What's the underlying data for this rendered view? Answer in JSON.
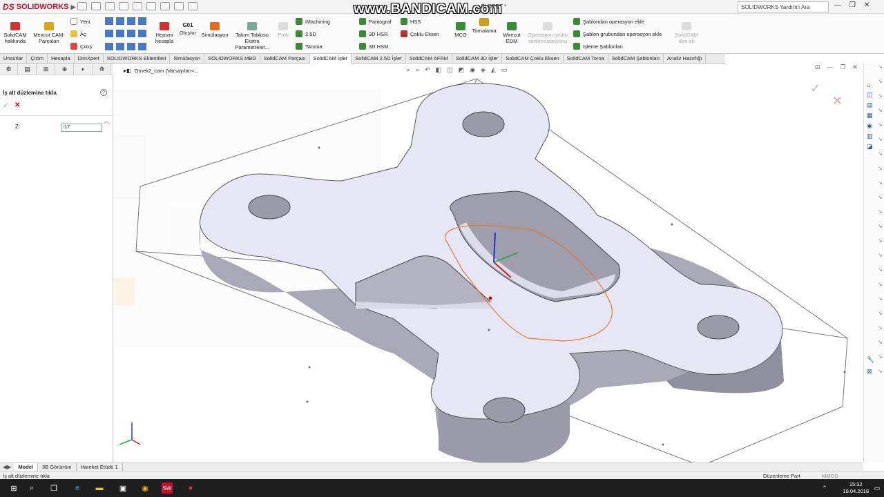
{
  "app": {
    "brand": "SOLIDWORKS",
    "watermark": "www.BANDICAM.com",
    "document_title": "...SLDPRT *"
  },
  "search": {
    "placeholder": "SOLIDWORKS Yardım'ı Ara"
  },
  "ribbon": {
    "solidcam_about": "SolidCAM hakkında",
    "existing_parts": "Mevcut CAM-Parçaları",
    "new": "Yeni",
    "open": "Aç",
    "exit": "Çıkış",
    "calc_all": "Hepsini hesapla",
    "gcode": "G01",
    "create": "Oluştur",
    "simulation": "Simülasyon",
    "tool_table_params": "Takım Tablosu Ekstra Parametreler...",
    "probe": "Prob",
    "imachining": "iMachining",
    "op25d": "2.5D",
    "definition": "Tanıma",
    "pantograph": "Pantograf",
    "hsr3d": "3D HSR",
    "hsm3d": "3D HSM",
    "hss": "HSS",
    "multiaxis": "Çoklu Eksen",
    "mco": "MCO",
    "turning": "Tornalama",
    "wirecut": "Wirecut EDM",
    "op_group_sync": "Operasyon grubu senkronizasyonu",
    "add_from_template": "Şablondan operasyon ekle",
    "add_from_group_template": "Şablon grubundan operasyon ekle",
    "process_templates": "İşleme Şablonları",
    "solidcam_more": "SolidCAM den.ok"
  },
  "tabs": [
    "Unsurlar",
    "Çizim",
    "Hesapla",
    "DimXpert",
    "SOLIDWORKS Eklentileri",
    "Simülasyon",
    "SOLIDWORKS MBD",
    "SolidCAM Parçası",
    "SolidCAM İşler",
    "SolidCAM 2.5D İşler",
    "SolidCAM AFRM",
    "SolidCAM 3D İşler",
    "SolidCAM Çoklu Eksen",
    "SolidCAM Torna",
    "SolidCAM Şablonları",
    "Analiz Hazırlığı"
  ],
  "active_tab": "SolidCAM İşler",
  "property_manager": {
    "title": "İş alt düzlemine tıkla",
    "z_label": "Z:",
    "z_value": "-17"
  },
  "tree": {
    "root": "Ornek2_cam  (Varsayılan<..."
  },
  "bottom_tabs": [
    "Model",
    "3B Görünüm",
    "Hareket Etüdü 1"
  ],
  "status": {
    "left": "İş alt düzlemine tıkla",
    "mode": "Düzenleme Part",
    "units": "MMGS"
  },
  "taskbar": {
    "time": "15:32",
    "date": "19.04.2018"
  },
  "colors": {
    "accent": "#c8102e",
    "part_face": "#e6e6f4",
    "part_side": "#8f8f9e",
    "tab_active": "#ffffff"
  }
}
